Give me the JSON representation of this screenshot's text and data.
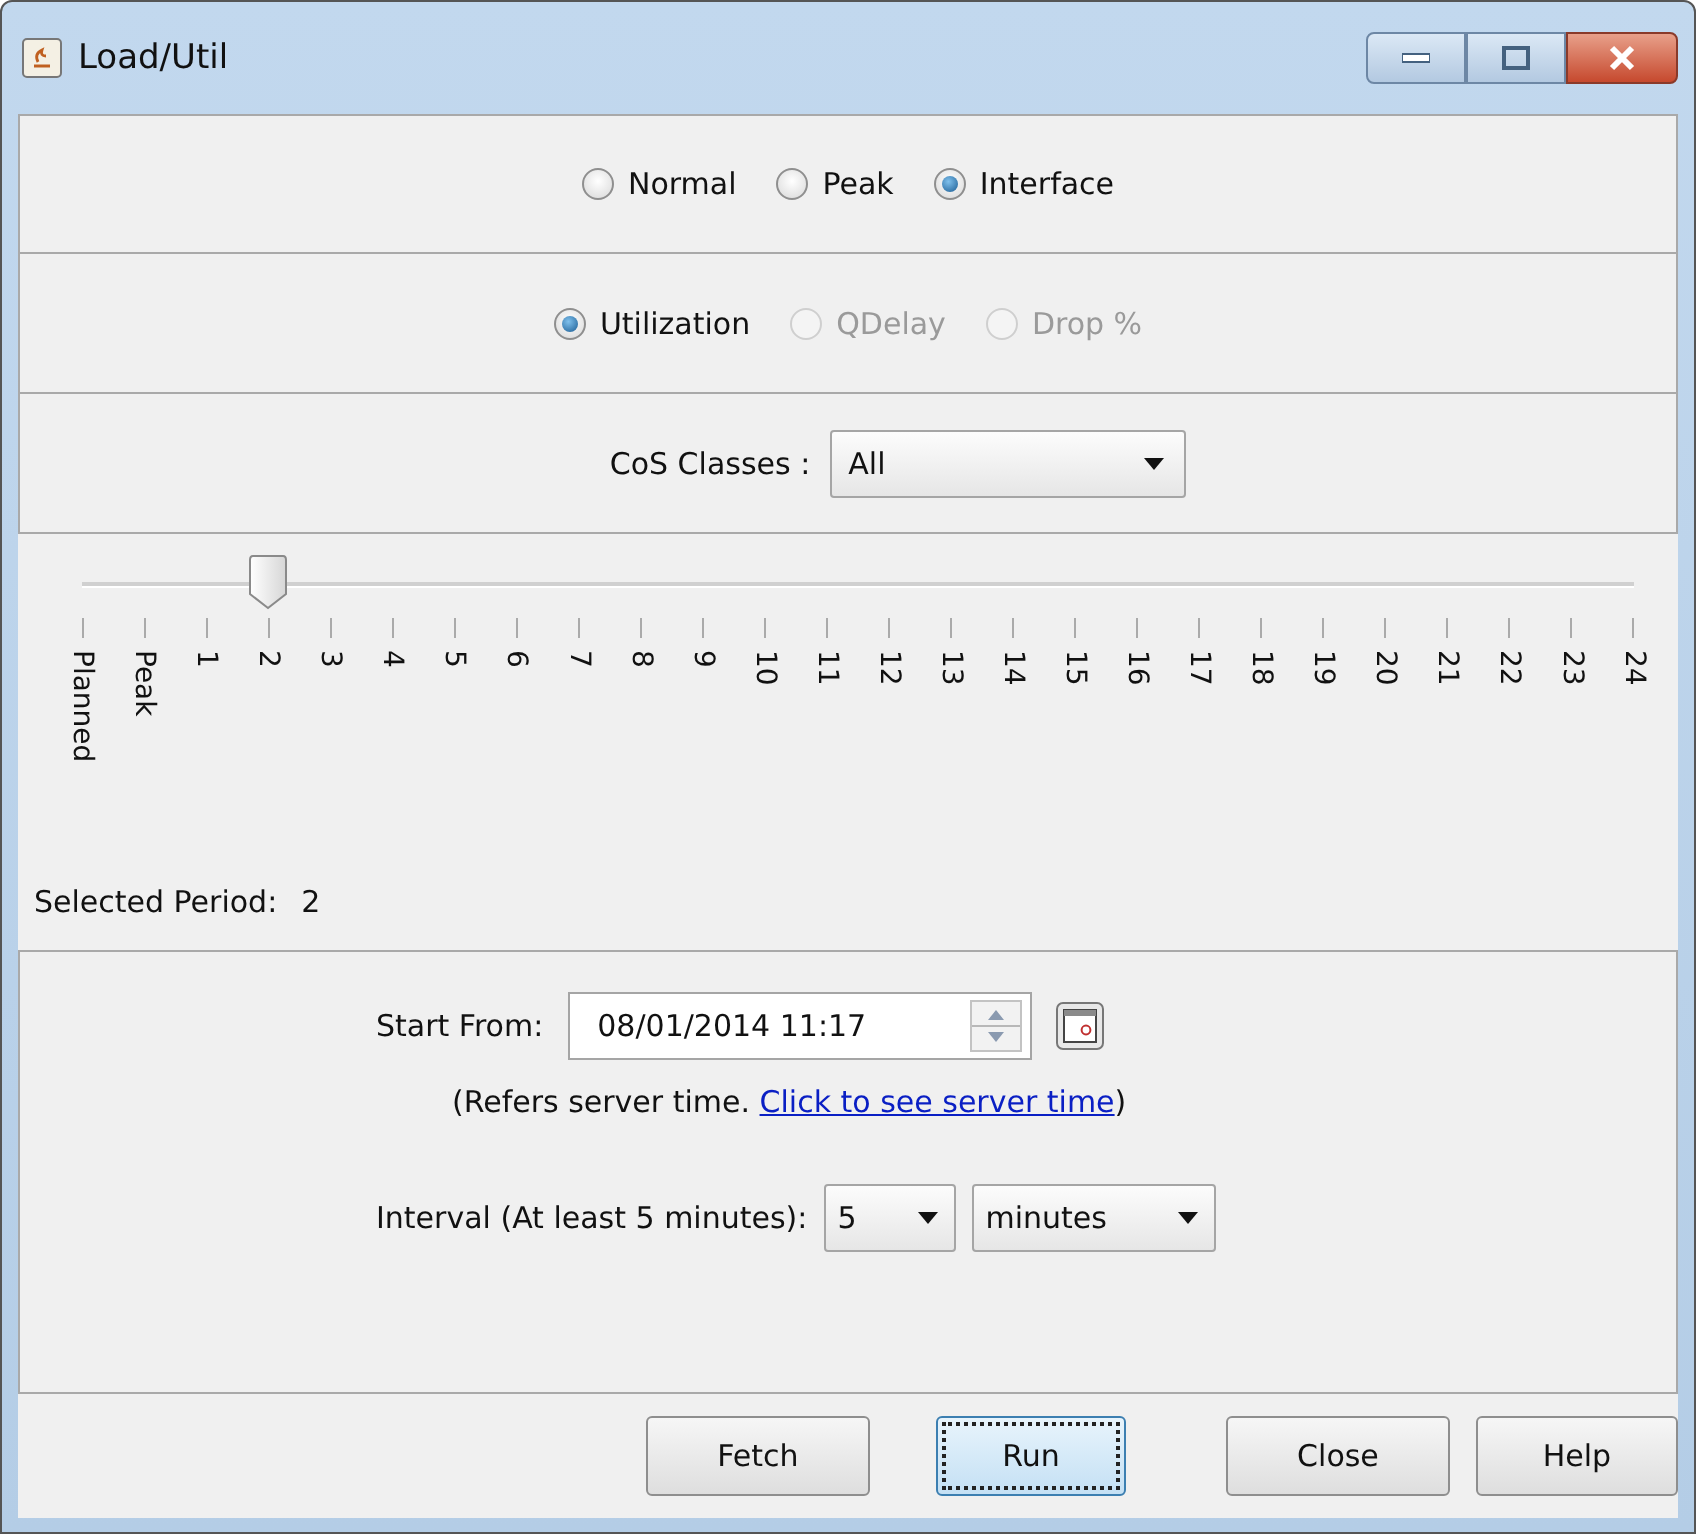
{
  "window": {
    "title": "Load/Util"
  },
  "mode_options": [
    {
      "label": "Normal",
      "selected": false,
      "disabled": false
    },
    {
      "label": "Peak",
      "selected": false,
      "disabled": false
    },
    {
      "label": "Interface",
      "selected": true,
      "disabled": false
    }
  ],
  "metric_options": [
    {
      "label": "Utilization",
      "selected": true,
      "disabled": false
    },
    {
      "label": "QDelay",
      "selected": false,
      "disabled": true
    },
    {
      "label": "Drop %",
      "selected": false,
      "disabled": true
    }
  ],
  "cos_classes": {
    "label": "CoS Classes :",
    "value": "All"
  },
  "period_slider": {
    "level": 0.12,
    "ticks": [
      "Planned",
      "Peak",
      "1",
      "2",
      "3",
      "4",
      "5",
      "6",
      "7",
      "8",
      "9",
      "10",
      "11",
      "12",
      "13",
      "14",
      "15",
      "16",
      "17",
      "18",
      "19",
      "20",
      "21",
      "22",
      "23",
      "24"
    ]
  },
  "selected_period": {
    "label": "Selected Period:",
    "value": "2"
  },
  "start_from": {
    "label": "Start From:",
    "value": "08/01/2014 11:17"
  },
  "server_time_note": {
    "text": "(Refers server time. ",
    "link": "Click to see server time",
    "suffix": ")"
  },
  "interval": {
    "label": "Interval (At least 5 minutes):",
    "amount": "5",
    "unit": "minutes"
  },
  "buttons": [
    {
      "label": "Fetch",
      "focused": false
    },
    {
      "label": "Run",
      "focused": true
    },
    {
      "label": "Close",
      "focused": false
    },
    {
      "label": "Help",
      "focused": false
    }
  ]
}
